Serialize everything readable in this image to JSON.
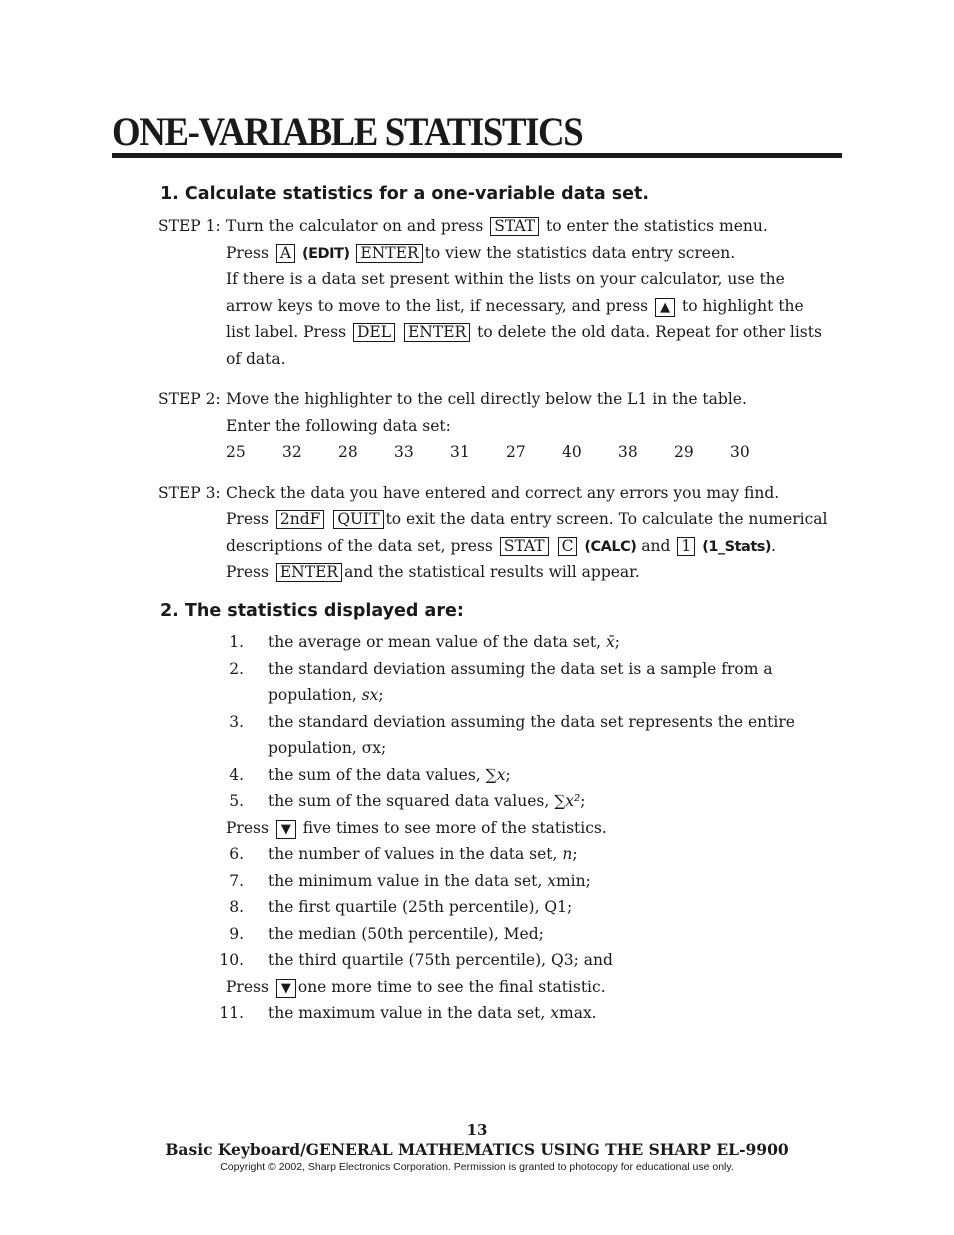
{
  "title": "ONE-VARIABLE STATISTICS",
  "section1": {
    "heading": "1.  Calculate statistics for a one-variable data set.",
    "step1": {
      "label": "STEP 1:",
      "l1a": "Turn the calculator on and press",
      "k_stat": "STAT",
      "l1b": "to enter the statistics menu.",
      "l2a": "Press",
      "k_a": "A",
      "l2b": "(EDIT)",
      "k_enter": "ENTER",
      "l2c": "to view the statistics data entry screen.",
      "l3": "If there is a data set present within the lists on your calculator,  use the",
      "l4a": "arrow keys to move to the list, if necessary, and press",
      "k_up": "▲",
      "l4b": "to highlight the",
      "l5a": "list label.  Press",
      "k_del": "DEL",
      "k_enter2": "ENTER",
      "l5b": "to delete the old data.  Repeat for other lists",
      "l6": "of data."
    },
    "step2": {
      "label": "STEP 2:",
      "l1": "Move the highlighter to the cell directly below the L1 in the table.",
      "l2": "Enter the following data set:",
      "data": [
        "25",
        "32",
        "28",
        "33",
        "31",
        "27",
        "40",
        "38",
        "29",
        "30"
      ]
    },
    "step3": {
      "label": "STEP 3:",
      "l1": "Check the data you have entered and correct any errors you may find.",
      "l2a": "Press",
      "k_2nd": "2ndF",
      "k_quit": "QUIT",
      "l2b": "to exit the data entry screen.  To calculate the numerical",
      "l3a": "descriptions of the data set, press",
      "k_stat": "STAT",
      "k_c": "C",
      "l3b": "(CALC)",
      "l3c": "and",
      "k_1": "1",
      "l3d": "(1_Stats)",
      "l3e": ".",
      "l4a": "Press",
      "k_enter": "ENTER",
      "l4b": "and the statistical results will appear."
    }
  },
  "section2": {
    "heading": "2.  The statistics displayed are:",
    "items": [
      {
        "n": "1.",
        "text": "the average or mean value of the data set, ",
        "sym": "x̄",
        "end": ";"
      },
      {
        "n": "2.",
        "text": "the standard deviation assuming the data set is a sample from a"
      },
      {
        "text": "population, ",
        "sym": "sx",
        "end": ";"
      },
      {
        "n": "3.",
        "text": "the standard deviation assuming the data set represents the entire"
      },
      {
        "text": "population, σx;"
      },
      {
        "n": "4.",
        "text": "the sum of the data values, ∑",
        "sym": "x",
        "end": ";"
      },
      {
        "n": "5.",
        "text": "the sum of the squared data values, ∑",
        "sym": "x²",
        "end": ";"
      },
      {
        "n": "6.",
        "text": "the number of values in the data set, ",
        "sym": "n",
        "end": ";"
      },
      {
        "n": "7.",
        "text": "the minimum value in the data set, ",
        "sym": "x",
        "end": "min;"
      },
      {
        "n": "8.",
        "text": "the first quartile (25th percentile), Q1;"
      },
      {
        "n": "9.",
        "text": "the median (50th percentile), Med;"
      },
      {
        "n": "10.",
        "text": "the third quartile (75th percentile), Q3; and"
      },
      {
        "n": "11.",
        "text": "the maximum value in the data set, ",
        "sym": "x",
        "end": "max."
      }
    ],
    "press1a": "Press",
    "k_down": "▼",
    "press1b": "five times to see more of the statistics.",
    "press2a": "Press",
    "press2b": "one more time to see the final statistic."
  },
  "footer": {
    "page": "13",
    "book": "Basic Keyboard/GENERAL MATHEMATICS USING THE SHARP EL-9900",
    "copyright": "Copyright © 2002, Sharp Electronics Corporation.  Permission is granted to photocopy for educational use only."
  }
}
